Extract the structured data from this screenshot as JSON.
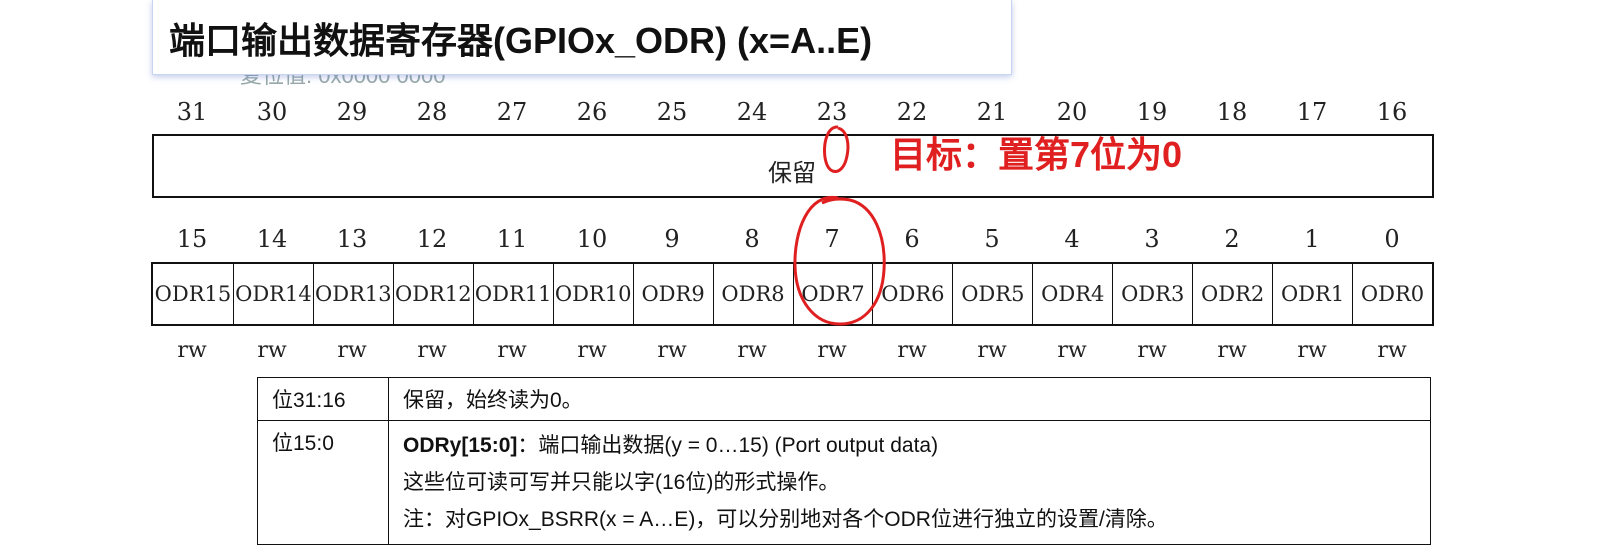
{
  "title": "端口输出数据寄存器(GPIOx_ODR) (x=A..E)",
  "ghost_text": "复位值: 0x0000 0000",
  "high_bits": [
    "31",
    "30",
    "29",
    "28",
    "27",
    "26",
    "25",
    "24",
    "23",
    "22",
    "21",
    "20",
    "19",
    "18",
    "17",
    "16"
  ],
  "reserved_label": "保留",
  "low_bits": [
    "15",
    "14",
    "13",
    "12",
    "11",
    "10",
    "9",
    "8",
    "7",
    "6",
    "5",
    "4",
    "3",
    "2",
    "1",
    "0"
  ],
  "fields": [
    "ODR15",
    "ODR14",
    "ODR13",
    "ODR12",
    "ODR11",
    "ODR10",
    "ODR9",
    "ODR8",
    "ODR7",
    "ODR6",
    "ODR5",
    "ODR4",
    "ODR3",
    "ODR2",
    "ODR1",
    "ODR0"
  ],
  "access": [
    "rw",
    "rw",
    "rw",
    "rw",
    "rw",
    "rw",
    "rw",
    "rw",
    "rw",
    "rw",
    "rw",
    "rw",
    "rw",
    "rw",
    "rw",
    "rw"
  ],
  "annotation": "目标：置第7位为0",
  "annotation_color": "#e02020",
  "table": {
    "row1": {
      "bits": "位31:16",
      "desc": "保留，始终读为0。"
    },
    "row2": {
      "bits": "位15:0",
      "name": "ODRy[15:0]",
      "name_desc": "：端口输出数据(y = 0…15) (Port output data)",
      "line2": "这些位可读可写并只能以字(16位)的形式操作。",
      "line3": "注：对GPIOx_BSRR(x = A…E)，可以分别地对各个ODR位进行独立的设置/清除。"
    }
  }
}
